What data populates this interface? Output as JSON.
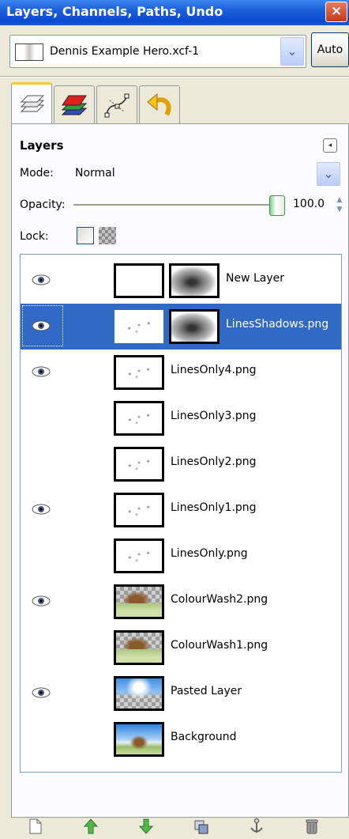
{
  "window": {
    "title": "Layers, Channels, Paths, Undo",
    "close_glyph": "×"
  },
  "image_selector": {
    "value": "Dennis Example Hero.xcf-1",
    "auto_label": "Auto",
    "arrow_glyph": "⌄"
  },
  "tabs": [
    {
      "name": "layers-tab-icon",
      "active": true
    },
    {
      "name": "channels-tab-icon",
      "active": false
    },
    {
      "name": "paths-tab-icon",
      "active": false
    },
    {
      "name": "undo-tab-icon",
      "active": false
    }
  ],
  "panel": {
    "title": "Layers",
    "menu_glyph": "◂",
    "mode_label": "Mode:",
    "mode_value": "Normal",
    "opacity_label": "Opacity:",
    "opacity_value": "100.0",
    "opacity_fraction": 1.0,
    "lock_label": "Lock:"
  },
  "layers": [
    {
      "name": "New Layer",
      "visible": true,
      "mask": true,
      "selected": false
    },
    {
      "name": "LinesShadows.png",
      "visible": true,
      "mask": true,
      "selected": true
    },
    {
      "name": "LinesOnly4.png",
      "visible": true,
      "mask": false,
      "selected": false
    },
    {
      "name": "LinesOnly3.png",
      "visible": false,
      "mask": false,
      "selected": false
    },
    {
      "name": "LinesOnly2.png",
      "visible": false,
      "mask": false,
      "selected": false
    },
    {
      "name": "LinesOnly1.png",
      "visible": true,
      "mask": false,
      "selected": false
    },
    {
      "name": "LinesOnly.png",
      "visible": false,
      "mask": false,
      "selected": false
    },
    {
      "name": "ColourWash2.png",
      "visible": true,
      "mask": false,
      "selected": false
    },
    {
      "name": "ColourWash1.png",
      "visible": false,
      "mask": false,
      "selected": false
    },
    {
      "name": "Pasted Layer",
      "visible": true,
      "mask": false,
      "selected": false
    },
    {
      "name": "Background",
      "visible": false,
      "mask": false,
      "selected": false
    }
  ],
  "toolbar": [
    {
      "name": "new-layer-icon"
    },
    {
      "name": "raise-layer-icon"
    },
    {
      "name": "lower-layer-icon"
    },
    {
      "name": "duplicate-layer-icon"
    },
    {
      "name": "anchor-layer-icon"
    },
    {
      "name": "delete-layer-icon"
    }
  ]
}
